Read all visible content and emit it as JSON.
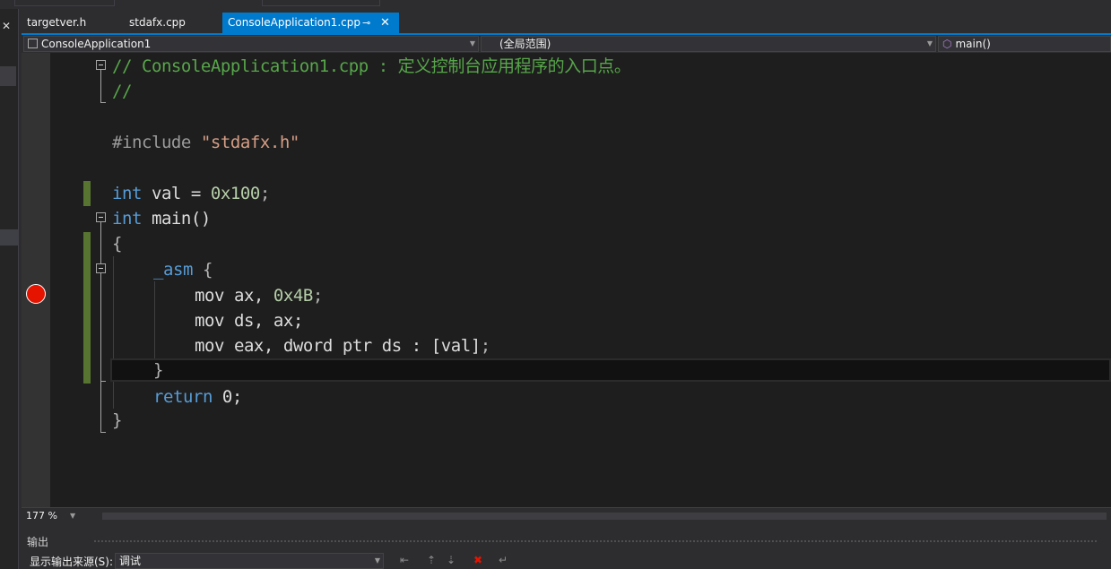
{
  "tabs": [
    {
      "label": "targetver.h",
      "active": false
    },
    {
      "label": "stdafx.cpp",
      "active": false
    },
    {
      "label": "ConsoleApplication1.cpp",
      "active": true
    }
  ],
  "tab_pin_icon": "pin-icon",
  "tab_close_glyph": "✕",
  "nav": {
    "project": "ConsoleApplication1",
    "scope": "(全局范围)",
    "member": "main()"
  },
  "code_lines": {
    "l1": "// ConsoleApplication1.cpp : 定义控制台应用程序的入口点。",
    "l2": "//",
    "l4_directive": "#include",
    "l4_string": "\"stdafx.h\"",
    "l6_kw": "int",
    "l6_rest": " val = ",
    "l6_num": "0x100",
    "l6_end": ";",
    "l7_kw": "int",
    "l7_rest": " main()",
    "l8": "{",
    "l9_kw": "_asm",
    "l9_rest": " {",
    "l10_a": "mov ax, ",
    "l10_num": "0x4B",
    "l10_end": ";",
    "l11": "mov ds, ax;",
    "l12_a": "mov eax, dword ptr ds : [val]",
    "l12_end": ";",
    "l13": "}",
    "l14_kw": "return",
    "l14_rest": " 0;",
    "l15": "}"
  },
  "colors": {
    "comment": "#57a64a",
    "keyword": "#569cd6",
    "string": "#d69d85",
    "number": "#b5cea8",
    "accent": "#007acc",
    "breakpoint": "#e51400"
  },
  "zoom": "177 %",
  "output": {
    "title": "输出",
    "source_label": "显示输出来源(S):",
    "source_value": "调试"
  }
}
